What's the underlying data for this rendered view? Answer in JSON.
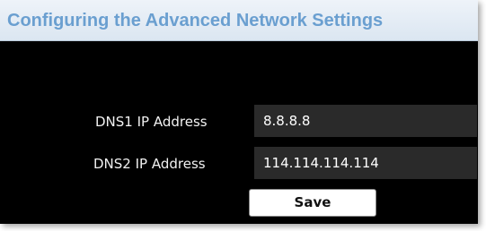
{
  "header": {
    "title": "Configuring the Advanced Network Settings"
  },
  "form": {
    "dns1": {
      "label": "DNS1 IP Address",
      "value": "8.8.8.8"
    },
    "dns2": {
      "label": "DNS2 IP Address",
      "value": "114.114.114.114"
    },
    "save_label": "Save"
  },
  "colors": {
    "header_text": "#6a9fd0",
    "panel_bg": "#050505",
    "input_bg": "#2a2a2a"
  }
}
